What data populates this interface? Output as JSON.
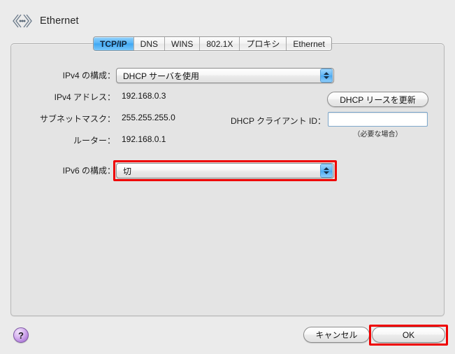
{
  "window": {
    "title": "Ethernet",
    "icon": "ethernet-icon"
  },
  "tabs": [
    {
      "label": "TCP/IP",
      "selected": true
    },
    {
      "label": "DNS",
      "selected": false
    },
    {
      "label": "WINS",
      "selected": false
    },
    {
      "label": "802.1X",
      "selected": false
    },
    {
      "label": "プロキシ",
      "selected": false
    },
    {
      "label": "Ethernet",
      "selected": false
    }
  ],
  "form": {
    "ipv4_config_label": "IPv4 の構成：",
    "ipv4_config_value": "DHCP サーバを使用",
    "ipv4_address_label": "IPv4 アドレス：",
    "ipv4_address_value": "192.168.0.3",
    "subnet_mask_label": "サブネットマスク：",
    "subnet_mask_value": "255.255.255.0",
    "router_label": "ルーター：",
    "router_value": "192.168.0.1",
    "ipv6_config_label": "IPv6 の構成：",
    "ipv6_config_value": "切"
  },
  "dhcp": {
    "renew_button": "DHCP リースを更新",
    "client_id_label": "DHCP クライアント ID：",
    "client_id_value": "",
    "client_id_placeholder": "",
    "client_id_hint": "（必要な場合）"
  },
  "footer": {
    "help_icon": "?",
    "cancel_button": "キャンセル",
    "ok_button": "OK"
  },
  "highlights": {
    "accent_color": "#ef0000",
    "targets": [
      "ipv6-config-popup",
      "ok-button"
    ]
  }
}
